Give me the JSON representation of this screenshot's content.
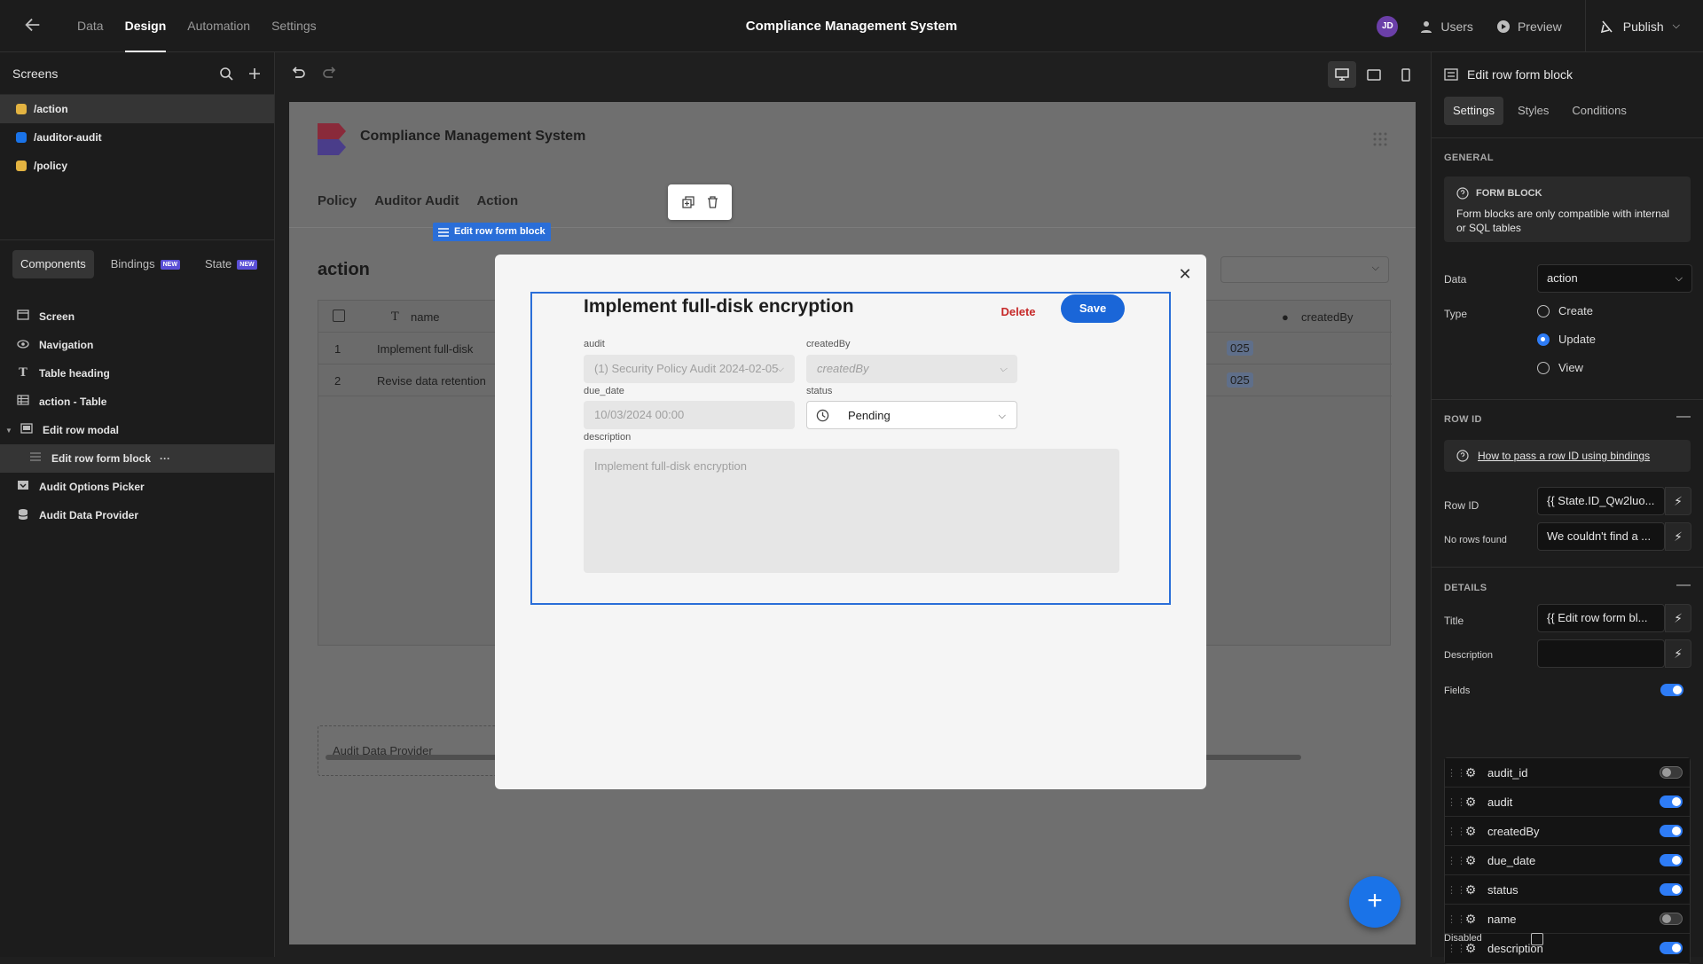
{
  "topbar": {
    "tabs": [
      "Data",
      "Design",
      "Automation",
      "Settings"
    ],
    "active_tab": "Design",
    "title": "Compliance Management System",
    "avatar_initials": "JD",
    "users_label": "Users",
    "preview_label": "Preview",
    "publish_label": "Publish"
  },
  "left": {
    "screens_title": "Screens",
    "screens": [
      {
        "route": "/action",
        "color": "#e3b341",
        "active": true
      },
      {
        "route": "/auditor-audit",
        "color": "#1a73e8",
        "active": false
      },
      {
        "route": "/policy",
        "color": "#e3b341",
        "active": false
      }
    ],
    "tabs": {
      "components": "Components",
      "bindings": "Bindings",
      "state": "State",
      "new_badge": "NEW"
    },
    "tree": [
      {
        "label": "Screen",
        "icon": "screen-icon"
      },
      {
        "label": "Navigation",
        "icon": "eye-icon"
      },
      {
        "label": "Table heading",
        "icon": "text-icon"
      },
      {
        "label": "action - Table",
        "icon": "table-icon"
      },
      {
        "label": "Edit row modal",
        "icon": "modal-icon"
      },
      {
        "label": "Edit row form block",
        "icon": "form-icon",
        "more": "···"
      },
      {
        "label": "Audit Options Picker",
        "icon": "picker-icon"
      },
      {
        "label": "Audit Data Provider",
        "icon": "database-icon"
      }
    ]
  },
  "canvas": {
    "app_name": "Compliance Management System",
    "nav": [
      "Policy",
      "Auditor Audit",
      "Action"
    ],
    "page_title": "action",
    "table_headers": {
      "name": "name",
      "created_by": "createdBy"
    },
    "table_rows": [
      {
        "idx": "1",
        "name": "Implement full-disk",
        "date_tail": "025"
      },
      {
        "idx": "2",
        "name": "Revise data retention",
        "date_tail": "025"
      }
    ],
    "provider_label": "Audit Data Provider"
  },
  "form": {
    "block_label": "Edit row form block",
    "title": "Implement full-disk encryption",
    "delete_label": "Delete",
    "save_label": "Save",
    "fields": {
      "audit": {
        "label": "audit",
        "value": "(1) Security Policy Audit 2024-02-05"
      },
      "created_by": {
        "label": "createdBy",
        "placeholder": "createdBy"
      },
      "due_date": {
        "label": "due_date",
        "value": "10/03/2024 00:00"
      },
      "status": {
        "label": "status",
        "value": "Pending"
      },
      "description": {
        "label": "description",
        "value": "Implement full-disk encryption"
      }
    }
  },
  "right": {
    "header": "Edit row form block",
    "tabs": [
      "Settings",
      "Styles",
      "Conditions"
    ],
    "general": {
      "section": "GENERAL",
      "info_title": "FORM BLOCK",
      "info_text": "Form blocks are only compatible with internal or SQL tables",
      "data_label": "Data",
      "data_value": "action",
      "type_label": "Type",
      "type_options": [
        "Create",
        "Update",
        "View"
      ],
      "type_selected": "Update"
    },
    "row_id": {
      "section": "ROW ID",
      "help_link": "How to pass a row ID using bindings",
      "row_id_label": "Row ID",
      "row_id_value": "{{ State.ID_Qw2luo...",
      "no_rows_label": "No rows found",
      "no_rows_value": "We couldn't find a ..."
    },
    "details": {
      "section": "DETAILS",
      "title_label": "Title",
      "title_value": "{{ Edit row form bl...",
      "description_label": "Description",
      "description_value": "",
      "fields_label": "Fields",
      "fields": [
        {
          "name": "audit_id",
          "enabled": false
        },
        {
          "name": "audit",
          "enabled": true
        },
        {
          "name": "createdBy",
          "enabled": true
        },
        {
          "name": "due_date",
          "enabled": true
        },
        {
          "name": "status",
          "enabled": true
        },
        {
          "name": "name",
          "enabled": false
        },
        {
          "name": "description",
          "enabled": true
        }
      ],
      "disabled_label": "Disabled"
    }
  }
}
